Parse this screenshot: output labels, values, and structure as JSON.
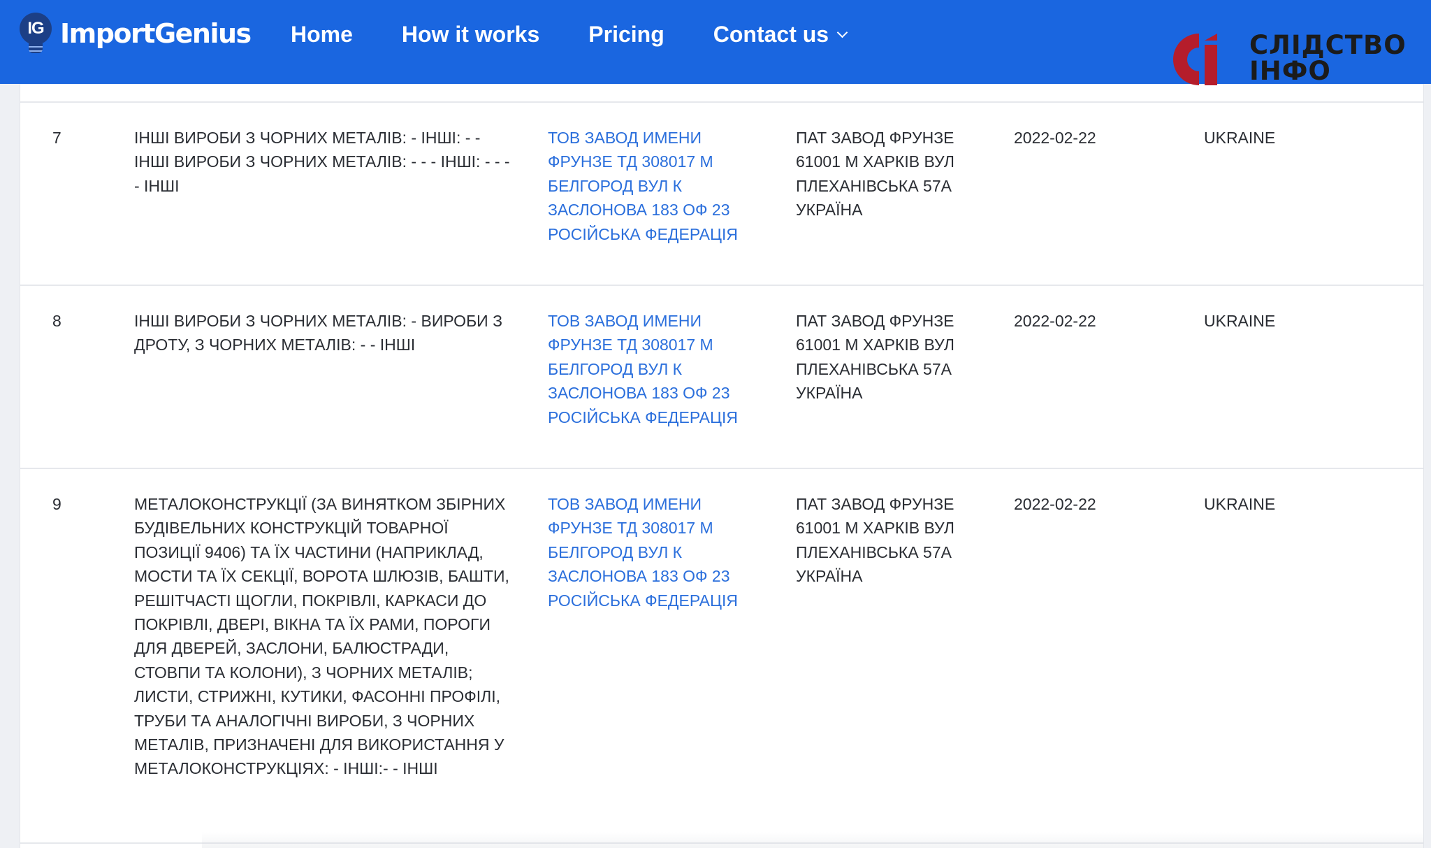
{
  "header": {
    "brand_icon": "IG",
    "brand_name": "ImportGenius",
    "nav": [
      {
        "label": "Home"
      },
      {
        "label": "How it works"
      },
      {
        "label": "Pricing"
      },
      {
        "label": "Contact us",
        "icon": "chevron-down-icon"
      }
    ],
    "bg_color": "#1a66e0"
  },
  "watermark": {
    "line1": "СЛІДСТВО",
    "line2": "ІНФО",
    "mark_color": "#b51d2b"
  },
  "table": {
    "link_color": "#2b6fdc",
    "rows": [
      {
        "num": "7",
        "description": "ІНШІ ВИРОБИ З ЧОРНИХ МЕТАЛІВ: - ІНШІ: - - ІНШІ ВИРОБИ З ЧОРНИХ МЕТАЛІВ: - - - ІНШІ: - - - - ІНШІ",
        "shipper": "ТОВ ЗАВОД ИМЕНИ ФРУНЗЕ ТД 308017 М БЕЛГОРОД ВУЛ К ЗАСЛОНОВА 183 ОФ 23 РОСІЙСЬКА ФЕДЕРАЦІЯ",
        "consignee": "ПАТ ЗАВОД ФРУНЗЕ 61001 М ХАРКІВ ВУЛ ПЛЕХАНІВСЬКА 57А УКРАЇНА",
        "date": "2022-02-22",
        "country": "UKRAINE"
      },
      {
        "num": "8",
        "description": "ІНШІ ВИРОБИ З ЧОРНИХ МЕТАЛІВ: - ВИРОБИ З ДРОТУ, З ЧОРНИХ МЕТАЛІВ: - - ІНШІ",
        "shipper": "ТОВ ЗАВОД ИМЕНИ ФРУНЗЕ ТД 308017 М БЕЛГОРОД ВУЛ К ЗАСЛОНОВА 183 ОФ 23 РОСІЙСЬКА ФЕДЕРАЦІЯ",
        "consignee": "ПАТ ЗАВОД ФРУНЗЕ 61001 М ХАРКІВ ВУЛ ПЛЕХАНІВСЬКА 57А УКРАЇНА",
        "date": "2022-02-22",
        "country": "UKRAINE"
      },
      {
        "num": "9",
        "description": "МЕТАЛОКОНСТРУКЦІЇ (ЗА ВИНЯТКОМ ЗБІРНИХ БУДІВЕЛЬНИХ КОНСТРУКЦІЙ ТОВАРНОЇ ПОЗИЦІЇ 9406) ТА ЇХ ЧАСТИНИ (НАПРИКЛАД, МОСТИ ТА ЇХ СЕКЦІЇ, ВОРОТА ШЛЮЗІВ, БАШТИ, РЕШІТЧАСТІ ЩОГЛИ, ПОКРІВЛІ, КАРКАСИ ДО ПОКРІВЛІ, ДВЕРІ, ВІКНА ТА ЇХ РАМИ, ПОРОГИ ДЛЯ ДВЕРЕЙ, ЗАСЛОНИ, БАЛЮСТРАДИ, СТОВПИ ТА КОЛОНИ), З ЧОРНИХ МЕТАЛІВ; ЛИСТИ, СТРИЖНІ, КУТИКИ, ФАСОННІ ПРОФІЛІ, ТРУБИ ТА АНАЛОГІЧНІ ВИРОБИ, З ЧОРНИХ МЕТАЛІВ, ПРИЗНАЧЕНІ ДЛЯ ВИКОРИСТАННЯ У МЕТАЛОКОНСТРУКЦІЯХ: - ІНШІ:- - ІНШІ",
        "shipper": "ТОВ ЗАВОД ИМЕНИ ФРУНЗЕ ТД 308017 М БЕЛГОРОД ВУЛ К ЗАСЛОНОВА 183 ОФ 23 РОСІЙСЬКА ФЕДЕРАЦІЯ",
        "consignee": "ПАТ ЗАВОД ФРУНЗЕ 61001 М ХАРКІВ ВУЛ ПЛЕХАНІВСЬКА 57А УКРАЇНА",
        "date": "2022-02-22",
        "country": "UKRAINE"
      }
    ]
  }
}
